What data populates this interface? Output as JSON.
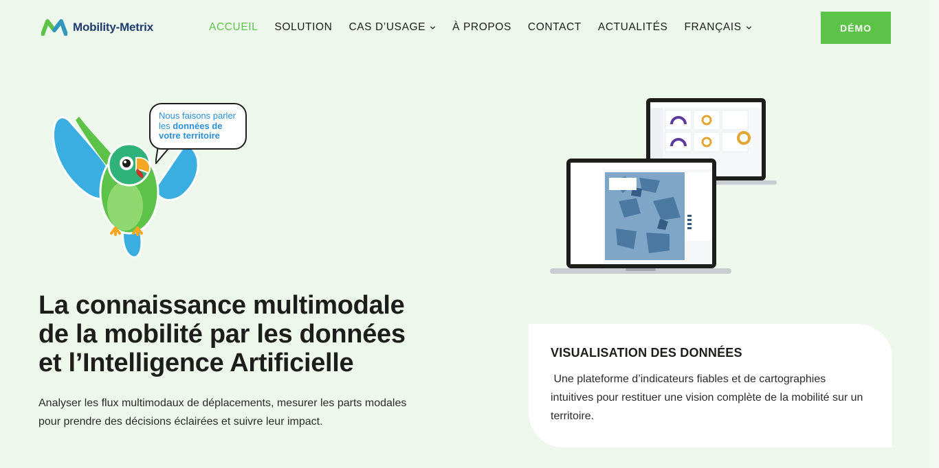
{
  "header": {
    "logo_text": "Mobility-Metrix",
    "nav": [
      {
        "label": "ACCUEIL",
        "active": true
      },
      {
        "label": "SOLUTION"
      },
      {
        "label": "CAS D’USAGE",
        "dropdown": true
      },
      {
        "label": "À PROPOS"
      },
      {
        "label": "CONTACT"
      },
      {
        "label": "ACTUALITÉS"
      },
      {
        "label": "FRANÇAIS",
        "dropdown": true
      }
    ],
    "demo_label": "DÉMO"
  },
  "bubble": {
    "line1": "Nous faisons parler",
    "line2_prefix": "les ",
    "line2_bold": "données de",
    "line3_bold": "votre territoire"
  },
  "hero": {
    "title_line1": "La connaissance multimodale",
    "title_line2": "de la mobilité par les données",
    "title_line3": "et l’Intelligence Artificielle",
    "subtitle_line1": "Analyser les flux multimodaux de déplacements, mesurer les parts modales",
    "subtitle_line2": "pour prendre des décisions éclairées et suivre leur impact."
  },
  "card": {
    "title": "VISUALISATION DES DONNÉES",
    "text": " Une plateforme d’indicateurs fiables et de cartographies intuitives pour restituer une vision complète de la mobilité sur un territoire."
  },
  "colors": {
    "accent_green": "#5cc348",
    "background": "#eef7ec",
    "brand_blue": "#2a8fd4",
    "logo_navy": "#1f3c6e"
  },
  "icons": {
    "logo": "mobility-metrix-logo-icon",
    "dropdown": "chevron-down-icon"
  }
}
